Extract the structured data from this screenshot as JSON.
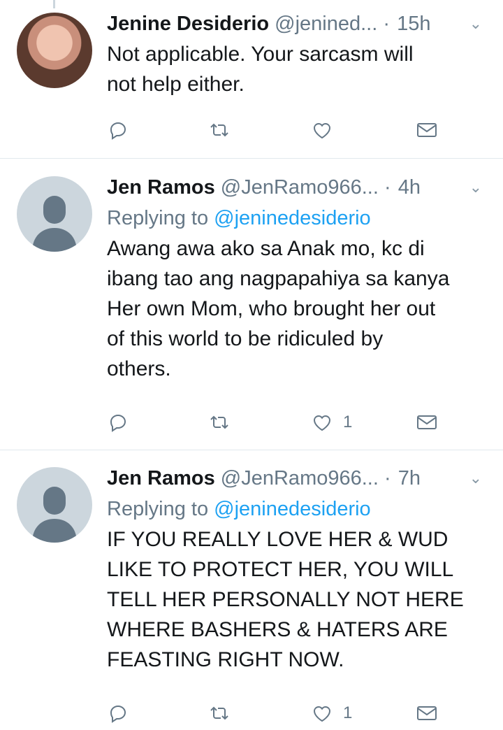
{
  "tweets": [
    {
      "name": "Jenine Desiderio",
      "handle": "@jenined...",
      "time": "15h",
      "replying_prefix": "",
      "replying_to": "",
      "lines": [
        "Not applicable. Your sarcasm will",
        "not help either."
      ],
      "likes": "",
      "avatar": "photo"
    },
    {
      "name": "Jen Ramos",
      "handle": "@JenRamo966...",
      "time": "4h",
      "replying_prefix": "Replying to ",
      "replying_to": "@jeninedesiderio",
      "lines": [
        "Awang awa ako sa Anak mo, kc di",
        "ibang tao ang nagpapahiya sa kanya",
        "Her own Mom, who brought her out",
        "of this world to be ridiculed by",
        "others."
      ],
      "likes": "1",
      "avatar": "default"
    },
    {
      "name": "Jen Ramos",
      "handle": "@JenRamo966...",
      "time": "7h",
      "replying_prefix": "Replying to ",
      "replying_to": "@jeninedesiderio",
      "lines": [
        "IF YOU REALLY LOVE HER & WUD",
        "LIKE TO PROTECT HER, YOU WILL",
        "TELL HER PERSONALLY NOT HERE",
        "WHERE BASHERS & HATERS ARE",
        "FEASTING RIGHT NOW."
      ],
      "likes": "1",
      "avatar": "default"
    }
  ],
  "separator": "·",
  "icons": [
    "reply-icon",
    "retweet-icon",
    "like-icon",
    "direct-message-icon",
    "chevron-down-icon"
  ],
  "colors": {
    "link": "#1da1f2",
    "muted": "#657786",
    "text": "#14171a",
    "divider": "#e1e8ed"
  }
}
